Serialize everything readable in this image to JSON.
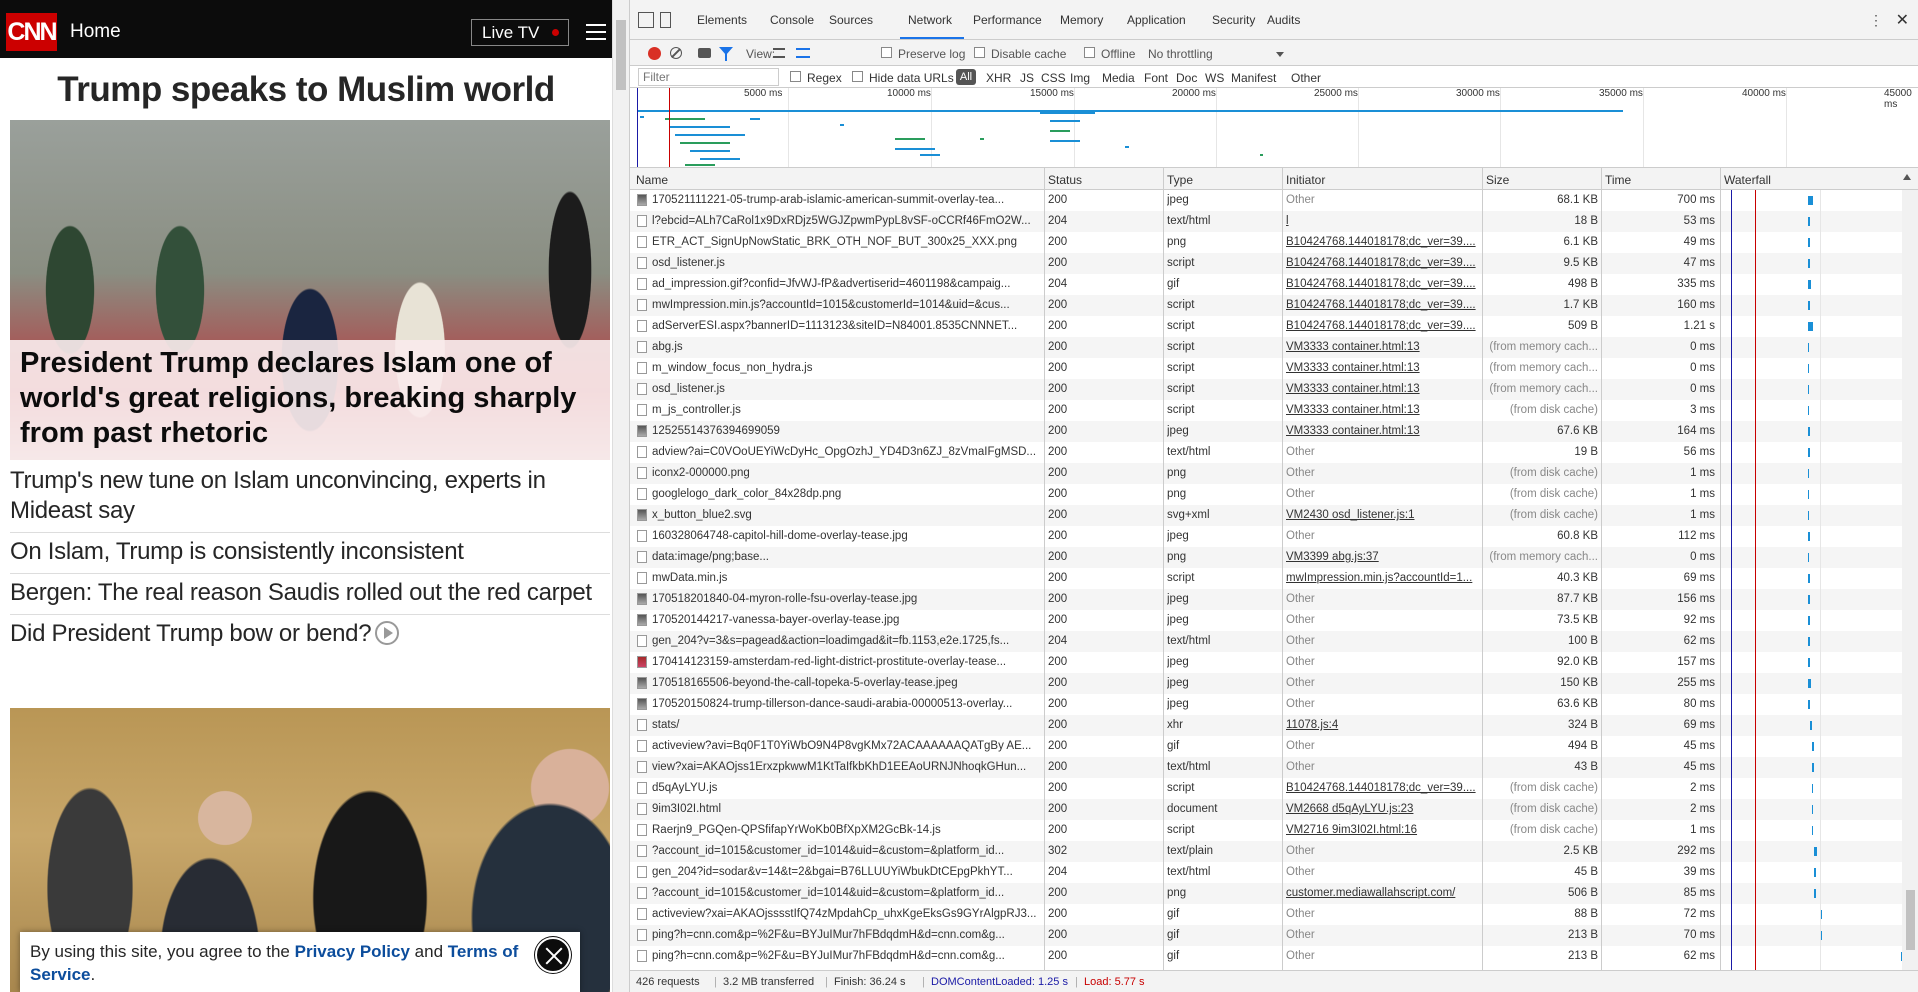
{
  "cnn": {
    "logo": "CNN",
    "nav_title": "Home",
    "live_tv_label": "Live TV",
    "top_headline": "Trump speaks to Muslim world",
    "hero_headline": "President Trump declares Islam one of world's great religions, breaking sharply from past rhetoric",
    "stories": [
      "Trump's new tune on Islam unconvincing, experts in Mideast say",
      "On Islam, Trump is consistently inconsistent",
      "Bergen: The real reason Saudis rolled out the red carpet",
      "Did President Trump bow or bend?"
    ],
    "consent": {
      "prefix": "By using this site, you agree to the",
      "privacy_link": "Privacy Policy",
      "and": "and",
      "terms_link": "Terms of Service",
      "suffix": "."
    }
  },
  "devtools": {
    "tabs": [
      "Elements",
      "Console",
      "Sources",
      "Network",
      "Performance",
      "Memory",
      "Application",
      "Security",
      "Audits"
    ],
    "active_tab": "Network",
    "toolbar": {
      "view_label": "View:",
      "preserve_log": "Preserve log",
      "disable_cache": "Disable cache",
      "offline": "Offline",
      "throttling": "No throttling"
    },
    "filter": {
      "placeholder": "Filter",
      "regex": "Regex",
      "hide_data_urls": "Hide data URLs",
      "types": [
        "All",
        "XHR",
        "JS",
        "CSS",
        "Img",
        "Media",
        "Font",
        "Doc",
        "WS",
        "Manifest",
        "Other"
      ]
    },
    "overview_ticks": [
      "5000 ms",
      "10000 ms",
      "15000 ms",
      "20000 ms",
      "25000 ms",
      "30000 ms",
      "35000 ms",
      "40000 ms",
      "45000 ms"
    ],
    "columns": [
      "Name",
      "Status",
      "Type",
      "Initiator",
      "Size",
      "Time",
      "Waterfall"
    ],
    "rows": [
      {
        "name": "170521111221-05-trump-arab-islamic-american-summit-overlay-tea...",
        "status": "200",
        "type": "jpeg",
        "initiator": "Other",
        "init_link": false,
        "size": "68.1 KB",
        "time": "700 ms",
        "icon": "img"
      },
      {
        "name": "l?ebcid=ALh7CaRol1x9DxRDjz5WGJZpwmPypL8vSF-oCCRf46FmO2W...",
        "status": "204",
        "type": "text/html",
        "initiator": "l",
        "init_link": true,
        "size": "18 B",
        "time": "53 ms",
        "icon": "doc"
      },
      {
        "name": "ETR_ACT_SignUpNowStatic_BRK_OTH_NOF_BUT_300x25_XXX.png",
        "status": "200",
        "type": "png",
        "initiator": "B10424768.144018178;dc_ver=39....",
        "init_link": true,
        "size": "6.1 KB",
        "time": "49 ms",
        "icon": "doc"
      },
      {
        "name": "osd_listener.js",
        "status": "200",
        "type": "script",
        "initiator": "B10424768.144018178;dc_ver=39....",
        "init_link": true,
        "size": "9.5 KB",
        "time": "47 ms",
        "icon": "doc"
      },
      {
        "name": "ad_impression.gif?confid=JfvWJ-fP&advertiserid=4601198&campaig...",
        "status": "204",
        "type": "gif",
        "initiator": "B10424768.144018178;dc_ver=39....",
        "init_link": true,
        "size": "498 B",
        "time": "335 ms",
        "icon": "doc"
      },
      {
        "name": "mwImpression.min.js?accountId=1015&customerId=1014&uid=&cus...",
        "status": "200",
        "type": "script",
        "initiator": "B10424768.144018178;dc_ver=39....",
        "init_link": true,
        "size": "1.7 KB",
        "time": "160 ms",
        "icon": "doc"
      },
      {
        "name": "adServerESI.aspx?bannerID=1113123&siteID=N84001.8535CNNNET...",
        "status": "200",
        "type": "script",
        "initiator": "B10424768.144018178;dc_ver=39....",
        "init_link": true,
        "size": "509 B",
        "time": "1.21 s",
        "icon": "doc"
      },
      {
        "name": "abg.js",
        "status": "200",
        "type": "script",
        "initiator": "VM3333 container.html:13",
        "init_link": true,
        "size": "(from memory cach...",
        "time": "0 ms",
        "icon": "doc"
      },
      {
        "name": "m_window_focus_non_hydra.js",
        "status": "200",
        "type": "script",
        "initiator": "VM3333 container.html:13",
        "init_link": true,
        "size": "(from memory cach...",
        "time": "0 ms",
        "icon": "doc"
      },
      {
        "name": "osd_listener.js",
        "status": "200",
        "type": "script",
        "initiator": "VM3333 container.html:13",
        "init_link": true,
        "size": "(from memory cach...",
        "time": "0 ms",
        "icon": "doc"
      },
      {
        "name": "m_js_controller.js",
        "status": "200",
        "type": "script",
        "initiator": "VM3333 container.html:13",
        "init_link": true,
        "size": "(from disk cache)",
        "time": "3 ms",
        "icon": "doc"
      },
      {
        "name": "12525514376394699059",
        "status": "200",
        "type": "jpeg",
        "initiator": "VM3333 container.html:13",
        "init_link": true,
        "size": "67.6 KB",
        "time": "164 ms",
        "icon": "img"
      },
      {
        "name": "adview?ai=C0VOoUEYiWcDyHc_OpgOzhJ_YD4D3n6ZJ_8zVmaIFgMSD...",
        "status": "200",
        "type": "text/html",
        "initiator": "Other",
        "init_link": false,
        "size": "19 B",
        "time": "56 ms",
        "icon": "doc"
      },
      {
        "name": "iconx2-000000.png",
        "status": "200",
        "type": "png",
        "initiator": "Other",
        "init_link": false,
        "size": "(from disk cache)",
        "time": "1 ms",
        "icon": "doc"
      },
      {
        "name": "googlelogo_dark_color_84x28dp.png",
        "status": "200",
        "type": "png",
        "initiator": "Other",
        "init_link": false,
        "size": "(from disk cache)",
        "time": "1 ms",
        "icon": "doc"
      },
      {
        "name": "x_button_blue2.svg",
        "status": "200",
        "type": "svg+xml",
        "initiator": "VM2430 osd_listener.js:1",
        "init_link": true,
        "size": "(from disk cache)",
        "time": "1 ms",
        "icon": "img"
      },
      {
        "name": "160328064748-capitol-hill-dome-overlay-tease.jpg",
        "status": "200",
        "type": "jpeg",
        "initiator": "Other",
        "init_link": false,
        "size": "60.8 KB",
        "time": "112 ms",
        "icon": "doc"
      },
      {
        "name": "data:image/png;base...",
        "status": "200",
        "type": "png",
        "initiator": "VM3399 abg.js:37",
        "init_link": true,
        "size": "(from memory cach...",
        "time": "0 ms",
        "icon": "doc"
      },
      {
        "name": "mwData.min.js",
        "status": "200",
        "type": "script",
        "initiator": "mwImpression.min.js?accountId=1...",
        "init_link": true,
        "size": "40.3 KB",
        "time": "69 ms",
        "icon": "doc"
      },
      {
        "name": "170518201840-04-myron-rolle-fsu-overlay-tease.jpg",
        "status": "200",
        "type": "jpeg",
        "initiator": "Other",
        "init_link": false,
        "size": "87.7 KB",
        "time": "156 ms",
        "icon": "img"
      },
      {
        "name": "170520144217-vanessa-bayer-overlay-tease.jpg",
        "status": "200",
        "type": "jpeg",
        "initiator": "Other",
        "init_link": false,
        "size": "73.5 KB",
        "time": "92 ms",
        "icon": "img"
      },
      {
        "name": "gen_204?v=3&s=pagead&action=loadimgad&it=fb.1153,e2e.1725,fs...",
        "status": "204",
        "type": "text/html",
        "initiator": "Other",
        "init_link": false,
        "size": "100 B",
        "time": "62 ms",
        "icon": "doc"
      },
      {
        "name": "170414123159-amsterdam-red-light-district-prostitute-overlay-tease...",
        "status": "200",
        "type": "jpeg",
        "initiator": "Other",
        "init_link": false,
        "size": "92.0 KB",
        "time": "157 ms",
        "icon": "imgred"
      },
      {
        "name": "170518165506-beyond-the-call-topeka-5-overlay-tease.jpeg",
        "status": "200",
        "type": "jpeg",
        "initiator": "Other",
        "init_link": false,
        "size": "150 KB",
        "time": "255 ms",
        "icon": "img"
      },
      {
        "name": "170520150824-trump-tillerson-dance-saudi-arabia-00000513-overlay...",
        "status": "200",
        "type": "jpeg",
        "initiator": "Other",
        "init_link": false,
        "size": "63.6 KB",
        "time": "80 ms",
        "icon": "img"
      },
      {
        "name": "stats/",
        "status": "200",
        "type": "xhr",
        "initiator": "11078.js:4",
        "init_link": true,
        "size": "324 B",
        "time": "69 ms",
        "icon": "doc"
      },
      {
        "name": "activeview?avi=Bq0F1T0YiWbO9N4P8vgKMx72ACAAAAAAQATgBy AE...",
        "status": "200",
        "type": "gif",
        "initiator": "Other",
        "init_link": false,
        "size": "494 B",
        "time": "45 ms",
        "icon": "doc"
      },
      {
        "name": "view?xai=AKAOjss1ErxzpkwwM1KtTaIfkbKhD1EEAoURNJNhoqkGHun...",
        "status": "200",
        "type": "text/html",
        "initiator": "Other",
        "init_link": false,
        "size": "43 B",
        "time": "45 ms",
        "icon": "doc"
      },
      {
        "name": "d5qAyLYU.js",
        "status": "200",
        "type": "script",
        "initiator": "B10424768.144018178;dc_ver=39....",
        "init_link": true,
        "size": "(from disk cache)",
        "time": "2 ms",
        "icon": "doc"
      },
      {
        "name": "9im3I02I.html",
        "status": "200",
        "type": "document",
        "initiator": "VM2668 d5qAyLYU.js:23",
        "init_link": true,
        "size": "(from disk cache)",
        "time": "2 ms",
        "icon": "doc"
      },
      {
        "name": "Raerjn9_PGQen-QPSfifapYrWoKb0BfXpXM2GcBk-14.js",
        "status": "200",
        "type": "script",
        "initiator": "VM2716 9im3I02I.html:16",
        "init_link": true,
        "size": "(from disk cache)",
        "time": "1 ms",
        "icon": "doc"
      },
      {
        "name": "?account_id=1015&customer_id=1014&uid=&custom=&platform_id...",
        "status": "302",
        "type": "text/plain",
        "initiator": "Other",
        "init_link": false,
        "size": "2.5 KB",
        "time": "292 ms",
        "icon": "doc"
      },
      {
        "name": "gen_204?id=sodar&v=14&t=2&bgai=B76LLUUYiWbukDtCEpgPkhYT...",
        "status": "204",
        "type": "text/html",
        "initiator": "Other",
        "init_link": false,
        "size": "45 B",
        "time": "39 ms",
        "icon": "doc"
      },
      {
        "name": "?account_id=1015&customer_id=1014&uid=&custom=&platform_id...",
        "status": "200",
        "type": "png",
        "initiator": "customer.mediawallahscript.com/",
        "init_link": true,
        "size": "506 B",
        "time": "85 ms",
        "icon": "doc"
      },
      {
        "name": "activeview?xai=AKAOjsssstIfQ74zMpdahCp_uhxKgeEksGs9GYrAlgpRJ3...",
        "status": "200",
        "type": "gif",
        "initiator": "Other",
        "init_link": false,
        "size": "88 B",
        "time": "72 ms",
        "icon": "doc"
      },
      {
        "name": "ping?h=cnn.com&p=%2F&u=BYJuIMur7hFBdqdmH&d=cnn.com&g...",
        "status": "200",
        "type": "gif",
        "initiator": "Other",
        "init_link": false,
        "size": "213 B",
        "time": "70 ms",
        "icon": "doc"
      },
      {
        "name": "ping?h=cnn.com&p=%2F&u=BYJuIMur7hFBdqdmH&d=cnn.com&g...",
        "status": "200",
        "type": "gif",
        "initiator": "Other",
        "init_link": false,
        "size": "213 B",
        "time": "62 ms",
        "icon": "doc"
      }
    ],
    "status_bar": {
      "requests": "426 requests",
      "transferred": "3.2 MB transferred",
      "finish": "Finish: 36.24 s",
      "dom_content_loaded": "DOMContentLoaded: 1.25 s",
      "load": "Load: 5.77 s"
    },
    "colors": {
      "active_tab": "#1a73e8",
      "record": "#d93025",
      "dom_content_loaded": "#1a1aa6",
      "load": "#c80000",
      "waterfall_bar": "#1a8fd6",
      "overview_green": "#2a9d5c"
    }
  }
}
